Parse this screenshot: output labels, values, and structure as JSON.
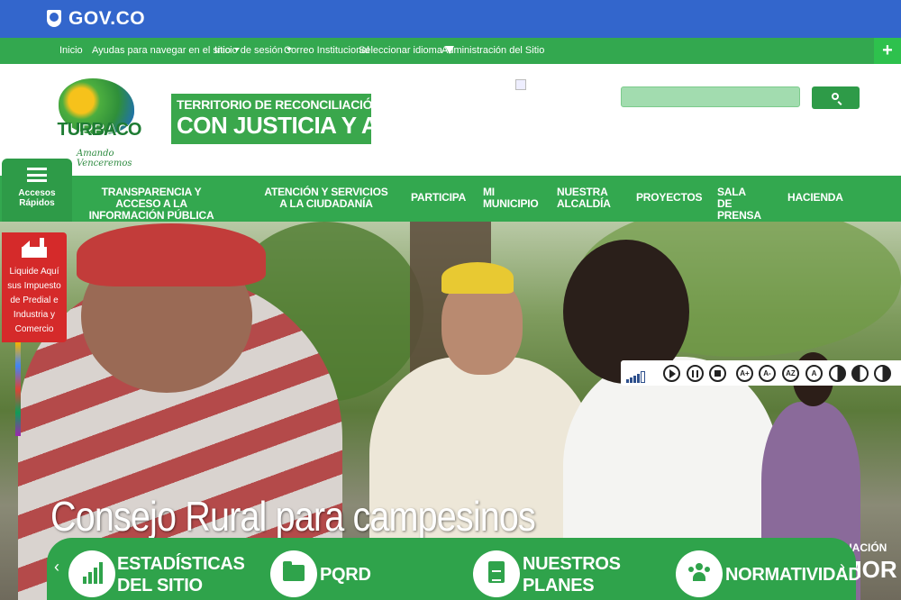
{
  "gov_bar": {
    "logo_text": "GOV.CO"
  },
  "top_nav": {
    "items": [
      "Inicio",
      "Ayudas para navegar en el sitio",
      "Inicio de sesión",
      "Correo Institucional",
      "Seleccionar idioma",
      "Administración del Sitio"
    ],
    "plus": "+"
  },
  "header": {
    "logo_name": "TURBACO",
    "logo_tagline": "Amando Venceremos",
    "slogan_line1": "TERRITORIO DE RECONCILIACIÓN Y PAZ",
    "slogan_line2": "CON JUSTICIA Y AMOR"
  },
  "main_nav": {
    "quick_access": "Accesos Rápidos",
    "items": [
      "TRANSPARENCIA Y ACCESO A LA INFORMACIÓN PÚBLICA",
      "ATENCIÓN Y SERVICIOS A LA CIUDADANÍA",
      "PARTICIPA",
      "MI MUNICIPIO",
      "NUESTRA ALCALDÍA",
      "PROYECTOS",
      "SALA DE PRENSA",
      "HACIENDA"
    ]
  },
  "hero": {
    "caption": "Consejo Rural para campesinos",
    "corner_line1": "LIACIÓN",
    "corner_line2": "MOR"
  },
  "tax_widget": {
    "text": "Liquide Aquí sus Impuesto de Predial e Industria y Comercio"
  },
  "accessibility": {
    "buttons": [
      "play",
      "pause",
      "stop",
      "A+",
      "A-",
      "AZ",
      "A",
      "contrast",
      "contrast-inverted",
      "contrast-alt"
    ]
  },
  "carousel": {
    "items": [
      {
        "label": "ESTADÍSTICAS DEL SITIO WEB",
        "icon": "bar-chart-icon"
      },
      {
        "label": "PQRD",
        "icon": "folder-icon"
      },
      {
        "label": "NUESTROS PLANES",
        "icon": "document-icon"
      },
      {
        "label": "NORMATIVIDAD",
        "icon": "users-icon"
      }
    ],
    "prev": "‹",
    "next": "›"
  },
  "colors": {
    "gov_blue": "#3366cc",
    "brand_green": "#33a84f",
    "alert_red": "#d52a2a"
  }
}
